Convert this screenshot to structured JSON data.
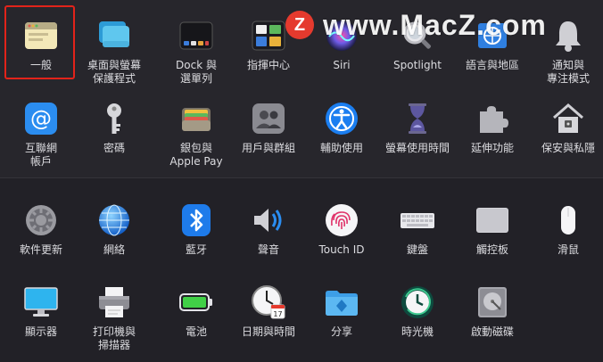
{
  "watermark": {
    "badge": "Z",
    "text": "www.MacZ.com"
  },
  "rows_top": [
    [
      {
        "id": "general",
        "label": "一般",
        "icon": "general-icon"
      },
      {
        "id": "desktop",
        "label": "桌面與螢幕\n保護程式",
        "icon": "desktop-icon"
      },
      {
        "id": "dock",
        "label": "Dock 與\n選單列",
        "icon": "dock-icon"
      },
      {
        "id": "mission",
        "label": "指揮中心",
        "icon": "mission-control-icon"
      },
      {
        "id": "siri",
        "label": "Siri",
        "icon": "siri-icon"
      },
      {
        "id": "spotlight",
        "label": "Spotlight",
        "icon": "spotlight-icon"
      },
      {
        "id": "language",
        "label": "語言與地區",
        "icon": "language-icon"
      },
      {
        "id": "notifications",
        "label": "通知與\n專注模式",
        "icon": "notifications-icon"
      }
    ],
    [
      {
        "id": "internet",
        "label": "互聯網\n帳戶",
        "icon": "at-icon"
      },
      {
        "id": "passwords",
        "label": "密碼",
        "icon": "key-icon"
      },
      {
        "id": "wallet",
        "label": "銀包與\nApple Pay",
        "icon": "wallet-icon"
      },
      {
        "id": "users",
        "label": "用戶與群組",
        "icon": "users-icon"
      },
      {
        "id": "accessibility",
        "label": "輔助使用",
        "icon": "accessibility-icon"
      },
      {
        "id": "screentime",
        "label": "螢幕使用時間",
        "icon": "hourglass-icon"
      },
      {
        "id": "extensions",
        "label": "延伸功能",
        "icon": "puzzle-icon"
      },
      {
        "id": "security",
        "label": "保安與私隱",
        "icon": "house-lock-icon"
      }
    ]
  ],
  "rows_bottom": [
    [
      {
        "id": "software",
        "label": "軟件更新",
        "icon": "gear-icon"
      },
      {
        "id": "network",
        "label": "網絡",
        "icon": "globe-icon"
      },
      {
        "id": "bluetooth",
        "label": "藍牙",
        "icon": "bluetooth-icon"
      },
      {
        "id": "sound",
        "label": "聲音",
        "icon": "speaker-icon"
      },
      {
        "id": "touchid",
        "label": "Touch ID",
        "icon": "fingerprint-icon"
      },
      {
        "id": "keyboard",
        "label": "鍵盤",
        "icon": "keyboard-icon"
      },
      {
        "id": "trackpad",
        "label": "觸控板",
        "icon": "trackpad-icon"
      },
      {
        "id": "mouse",
        "label": "滑鼠",
        "icon": "mouse-icon"
      }
    ],
    [
      {
        "id": "displays",
        "label": "顯示器",
        "icon": "display-icon"
      },
      {
        "id": "printers",
        "label": "打印機與\n掃描器",
        "icon": "printer-icon"
      },
      {
        "id": "battery",
        "label": "電池",
        "icon": "battery-icon"
      },
      {
        "id": "datetime",
        "label": "日期與時間",
        "icon": "clock-icon"
      },
      {
        "id": "sharing",
        "label": "分享",
        "icon": "folder-share-icon"
      },
      {
        "id": "timemachine",
        "label": "時光機",
        "icon": "time-machine-icon"
      },
      {
        "id": "startup",
        "label": "啟動磁碟",
        "icon": "disk-icon"
      }
    ]
  ],
  "selected": "general",
  "calendar_day": "17"
}
